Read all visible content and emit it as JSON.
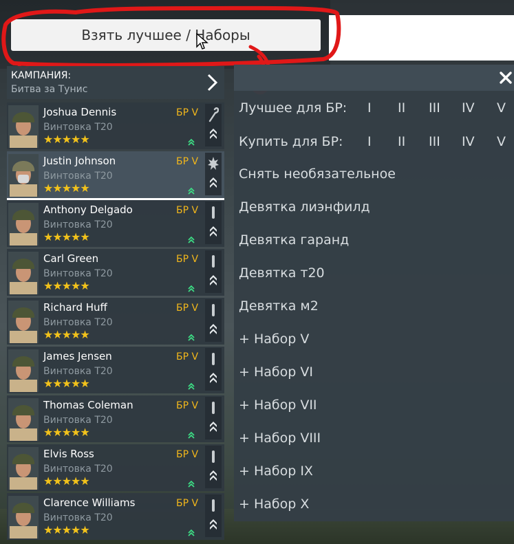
{
  "top_button": {
    "label": "Взять лучшее / Наборы"
  },
  "campaign": {
    "title": "КАМПАНИЯ:",
    "subtitle": "Битва за Тунис",
    "arrow_icon": "chevron-right-icon"
  },
  "soldiers": [
    {
      "name": "Joshua Dennis",
      "weapon": "Винтовка Т20",
      "br": "БР V",
      "stars": "★★★★★",
      "status_icon": "wrench-icon"
    },
    {
      "name": "Justin Johnson",
      "weapon": "Винтовка Т20",
      "br": "БР V",
      "stars": "★★★★★",
      "status_icon": "explosion-icon",
      "selected": true
    },
    {
      "name": "Anthony Delgado",
      "weapon": "Винтовка Т20",
      "br": "БР V",
      "stars": "★★★★★",
      "status_icon": "bullet-icon"
    },
    {
      "name": "Carl Green",
      "weapon": "Винтовка Т20",
      "br": "БР V",
      "stars": "★★★★★",
      "status_icon": "bullet-icon"
    },
    {
      "name": "Richard Huff",
      "weapon": "Винтовка Т20",
      "br": "БР V",
      "stars": "★★★★★",
      "status_icon": "bullet-icon"
    },
    {
      "name": "James Jensen",
      "weapon": "Винтовка Т20",
      "br": "БР V",
      "stars": "★★★★★",
      "status_icon": "bullet-icon"
    },
    {
      "name": "Thomas Coleman",
      "weapon": "Винтовка Т20",
      "br": "БР V",
      "stars": "★★★★★",
      "status_icon": "bullet-icon"
    },
    {
      "name": "Elvis Ross",
      "weapon": "Винтовка Т20",
      "br": "БР V",
      "stars": "★★★★★",
      "status_icon": "bullet-icon"
    },
    {
      "name": "Clarence Williams",
      "weapon": "Винтовка Т20",
      "br": "БР V",
      "stars": "★★★★★",
      "status_icon": "bullet-icon"
    }
  ],
  "menu": {
    "best_for_br": {
      "label": "Лучшее для БР:",
      "tiers": [
        "I",
        "II",
        "III",
        "IV",
        "V"
      ]
    },
    "buy_for_br": {
      "label": "Купить для БР:",
      "tiers": [
        "I",
        "II",
        "III",
        "IV",
        "V"
      ]
    },
    "items": [
      "Снять необязательное",
      "Девятка лиэнфилд",
      "Девятка гаранд",
      "Девятка т20",
      "Девятка м2",
      "+ Набор V",
      "+ Набор VI",
      "+ Набор VII",
      "+ Набор VIII",
      "+ Набор IX",
      "+ Набор X"
    ]
  },
  "colors": {
    "br": "#f2b71b",
    "stars": "#f2c21b",
    "rank_up": "#3ddc84",
    "annotation": "#e01818"
  }
}
